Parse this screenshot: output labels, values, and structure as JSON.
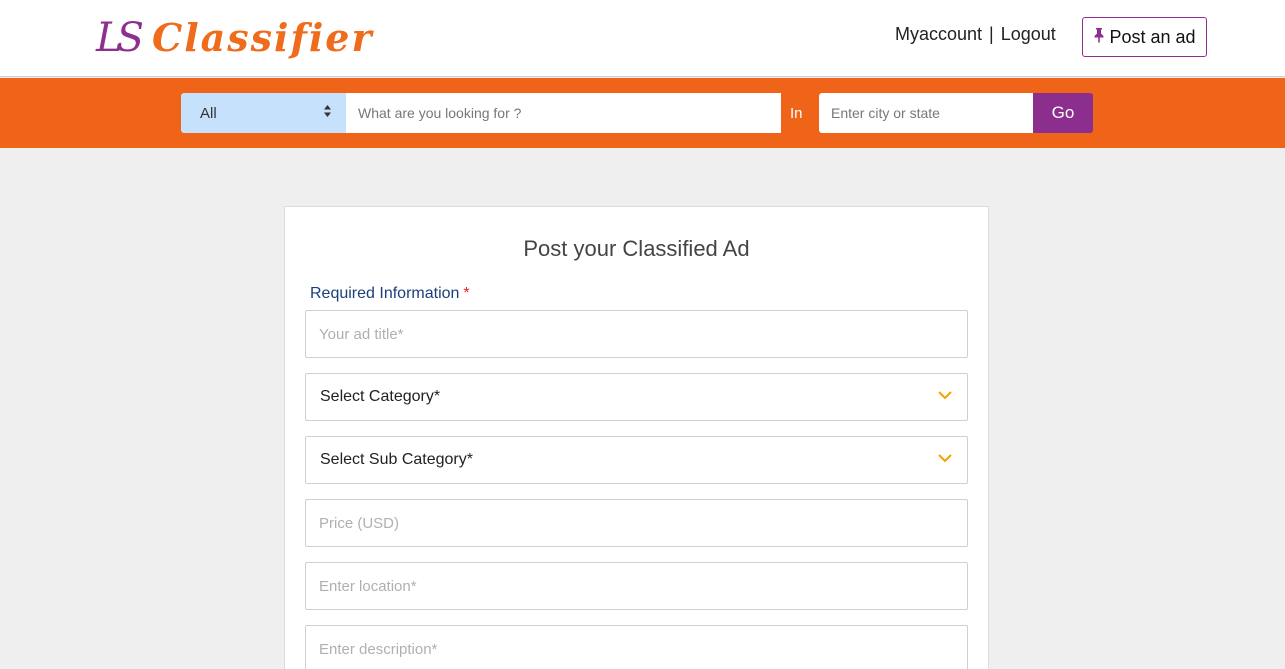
{
  "header": {
    "logo_mark": "LS",
    "logo_text": "Classifier",
    "my_account": "Myaccount",
    "separator": "|",
    "logout": "Logout",
    "post_ad_label": "Post an ad",
    "post_ad_icon": "pushpin-icon"
  },
  "search": {
    "category_value": "All",
    "query_placeholder": "What are you looking for ?",
    "in_label": "In",
    "city_placeholder": "Enter city or state",
    "go_label": "Go"
  },
  "form": {
    "title": "Post your Classified Ad",
    "required_label": "Required Information",
    "required_star": "*",
    "ad_title_placeholder": "Your ad title*",
    "category_label": "Select Category*",
    "sub_category_label": "Select Sub Category*",
    "price_placeholder": "Price (USD)",
    "location_placeholder": "Enter location*",
    "description_placeholder": "Enter description*"
  },
  "colors": {
    "brand_orange": "#ef6418",
    "brand_purple": "#8b2e8d",
    "chevron": "#f0a500"
  }
}
